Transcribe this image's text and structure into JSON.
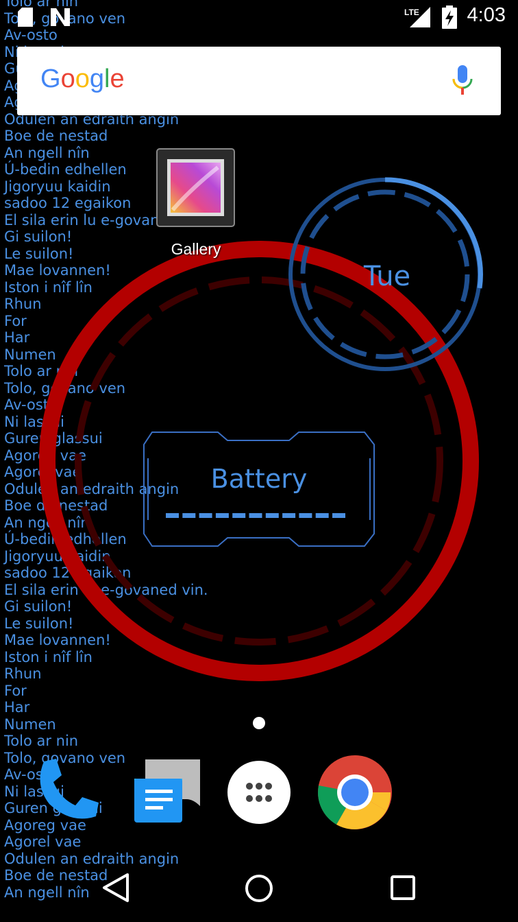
{
  "wallpaper_lines": [
    "Tolo ar nin",
    "Tolo, govano ven",
    "Av-osto",
    "Ni lassui",
    "Guren glassui",
    "Agoreg vae",
    "Agorel vae",
    "Odulen an edraith angin",
    "Boe de nestad",
    "An ngell nîn",
    "Ú-bedin edhellen",
    "Jigoryuu kaidin",
    "sadoo 12 egaikon",
    "El sila erin lu e-govaned vin.",
    "Gi suilon!",
    "Le suilon!",
    "Mae lovannen!",
    "Iston i nîf lîn",
    "Rhun",
    "For",
    "Har",
    "Numen",
    "Tolo ar nin",
    "Tolo, govano ven",
    "Av-osto",
    "Ni lassui",
    "Guren glassui",
    "Agoreg vae",
    "Agorel vae",
    "Odulen an edraith angin",
    "Boe de nestad",
    "An ngell nîn",
    "Ú-bedin edhellen",
    "Jigoryuu kaidin",
    "sadoo 12 egaikon",
    "El sila erin lu e-govaned vin.",
    "Gi suilon!",
    "Le suilon!",
    "Mae lovannen!",
    "Iston i nîf lîn",
    "Rhun",
    "For",
    "Har",
    "Numen",
    "Tolo ar nin",
    "Tolo, govano ven",
    "Av-osto",
    "Ni lassui",
    "Guren glassui",
    "Agoreg vae",
    "Agorel vae",
    "Odulen an edraith angin",
    "Boe de nestad",
    "An ngell nîn"
  ],
  "status_bar": {
    "time": "4:03",
    "network": "LTE",
    "icons": [
      "sd-card-icon",
      "notification-n-icon",
      "signal-icon",
      "battery-charging-icon"
    ]
  },
  "search": {
    "logo": [
      "G",
      "o",
      "o",
      "g",
      "l",
      "e"
    ],
    "logo_colors": [
      "#4285F4",
      "#EA4335",
      "#FBBC05",
      "#4285F4",
      "#34A853",
      "#EA4335"
    ],
    "mic_icon": "mic-icon"
  },
  "home_shortcut": {
    "label": "Gallery",
    "icon": "gallery-icon"
  },
  "widgets": {
    "day": "Tue",
    "battery_label": "Battery",
    "battery_level_segments": 11,
    "accent_blue": "#4a90e2",
    "ring_red": "#b30000"
  },
  "dock": {
    "apps": [
      "phone-icon",
      "messages-icon",
      "app-drawer-icon",
      "chrome-icon"
    ]
  },
  "nav": {
    "buttons": [
      "back-button",
      "home-button",
      "recents-button"
    ]
  }
}
